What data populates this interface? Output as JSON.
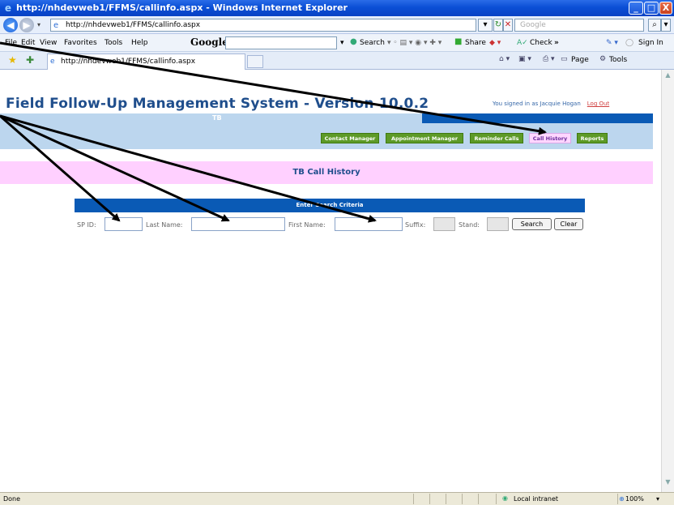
{
  "window": {
    "title": "http://nhdevweb1/FFMS/callinfo.aspx - Windows Internet Explorer",
    "minimize": "_",
    "maximize": "□",
    "close": "X"
  },
  "address_bar": {
    "url": "http://nhdevweb1/FFMS/callinfo.aspx",
    "search_placeholder": "Google"
  },
  "menu": [
    "File",
    "Edit",
    "View",
    "Favorites",
    "Tools",
    "Help"
  ],
  "google_toolbar": {
    "logo": "Google",
    "search": "Search",
    "share": "Share",
    "check": "Check",
    "more": "»",
    "sign_in": "Sign In"
  },
  "tab": {
    "label": "http://nhdevweb1/FFMS/callinfo.aspx"
  },
  "command_bar": {
    "page": "Page",
    "tools": "Tools"
  },
  "app": {
    "title": "Field Follow-Up Management System - Version 10.0.2",
    "signed_in": "You signed in as Jacquie Hogan",
    "logout": "Log Out",
    "section": "TB",
    "nav": [
      "Contact Manager",
      "Appointment Manager",
      "Reminder Calls",
      "Call History",
      "Reports"
    ],
    "active_nav": "Call History",
    "page_header": "TB Call History",
    "search_header": "Enter Search Criteria",
    "fields": {
      "sp_id": "SP ID:",
      "last_name": "Last Name:",
      "first_name": "First Name:",
      "suffix": "Suffix:",
      "stand": "Stand:"
    },
    "buttons": {
      "search": "Search",
      "clear": "Clear"
    }
  },
  "status": {
    "left": "Done",
    "zone": "Local intranet",
    "zoom": "100%"
  },
  "colors": {
    "title_blue": "#1f4e8c",
    "band_blue": "#0a5ab5",
    "light_blue": "#bcd6ee",
    "nav_green": "#5d9a27",
    "pink_header": "#ffd0ff"
  }
}
